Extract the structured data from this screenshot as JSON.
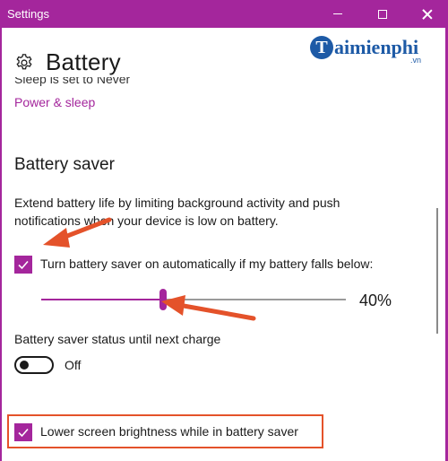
{
  "window": {
    "title": "Settings"
  },
  "header": {
    "title": "Battery"
  },
  "watermark": {
    "brand": "aimienphi",
    "mark": "T",
    "suffix": ".vn"
  },
  "sleep": {
    "text": "Sleep is set to Never",
    "link": "Power & sleep"
  },
  "battery_saver": {
    "title": "Battery saver",
    "description": "Extend battery life by limiting background activity and push notifications when your device is low on battery.",
    "auto_checkbox": {
      "label": "Turn battery saver on automatically if my battery falls below:",
      "checked": true
    },
    "threshold": {
      "value": 40,
      "display": "40%"
    },
    "status": {
      "label": "Battery saver status until next charge",
      "toggle_state": "Off"
    },
    "brightness_checkbox": {
      "label": "Lower screen brightness while in battery saver",
      "checked": true
    }
  },
  "colors": {
    "accent": "#a4269c",
    "annotation": "#e4522a",
    "brand": "#1d5aa6"
  },
  "icons": [
    "gear-icon",
    "minimize-icon",
    "maximize-icon",
    "close-icon",
    "checkmark-icon"
  ]
}
